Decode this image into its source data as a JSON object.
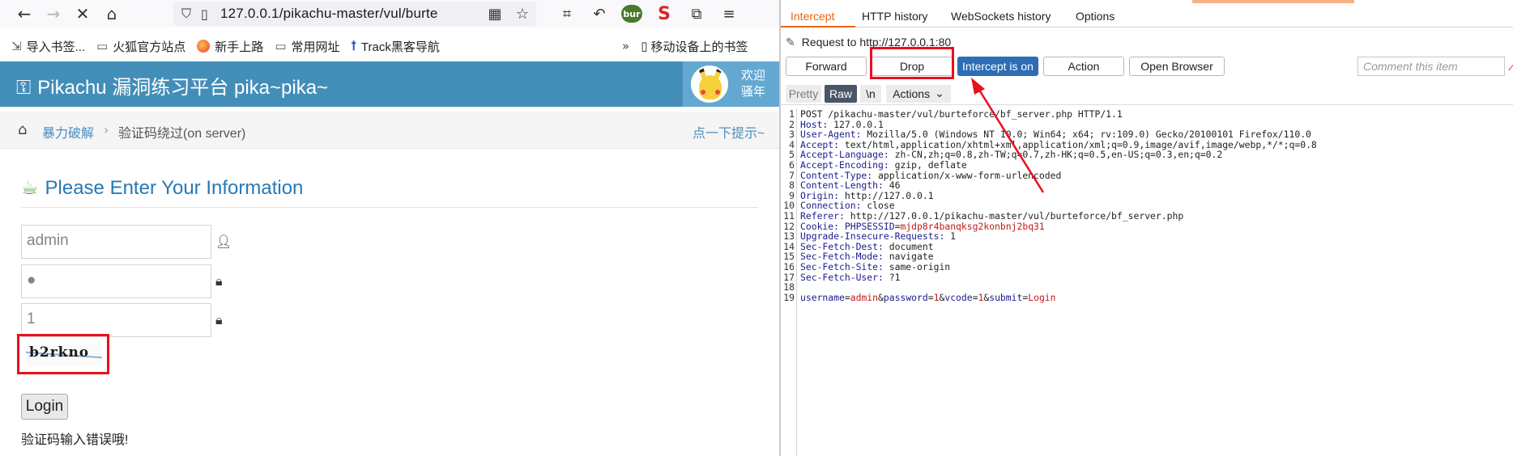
{
  "browser": {
    "nav": {
      "back_icon": "←",
      "forward_icon": "→",
      "stop_icon": "✕",
      "home_icon": "⌂"
    },
    "url": "127.0.0.1/pikachu-master/vul/burte",
    "bookmarks": [
      {
        "label": "导入书签...",
        "icon": "⇲"
      },
      {
        "label": "火狐官方站点",
        "icon": "folder"
      },
      {
        "label": "新手上路",
        "icon": "firefox"
      },
      {
        "label": "常用网址",
        "icon": "folder"
      },
      {
        "label": "Track黑客导航",
        "icon": "track"
      }
    ],
    "mobile_bookmarks": "移动设备上的书签",
    "burp_extension_badge": "bur",
    "s_extension_badge": "S"
  },
  "site": {
    "title": "Pikachu 漏洞练习平台 pika~pika~",
    "welcome_line1": "欢迎",
    "welcome_line2": "骚年",
    "breadcrumb_link": "暴力破解",
    "breadcrumb_current": "验证码绕过(on server)",
    "hint_link": "点一下提示~",
    "form_title": "Please Enter Your Information",
    "username_value": "admin",
    "password_value": "●",
    "vcode_value": "1",
    "captcha_text": "b2rkno",
    "login_label": "Login",
    "error_message": "验证码输入错误哦!"
  },
  "burp": {
    "tabs": [
      "Intercept",
      "HTTP history",
      "WebSockets history",
      "Options"
    ],
    "active_tab": "Intercept",
    "request_to": "Request to http://127.0.0.1:80",
    "buttons": {
      "forward": "Forward",
      "drop": "Drop",
      "intercept": "Intercept is on",
      "action": "Action",
      "open_browser": "Open Browser"
    },
    "comment_placeholder": "Comment this item",
    "view_buttons": {
      "pretty": "Pretty",
      "raw": "Raw",
      "newline": "\\n",
      "actions": "Actions"
    },
    "request_lines": [
      {
        "n": "1",
        "k": "",
        "v": "POST /pikachu-master/vul/burteforce/bf_server.php HTTP/1.1"
      },
      {
        "n": "2",
        "k": "Host",
        "v": "127.0.0.1"
      },
      {
        "n": "3",
        "k": "User-Agent",
        "v": "Mozilla/5.0 (Windows NT 10.0; Win64; x64; rv:109.0) Gecko/20100101 Firefox/110.0"
      },
      {
        "n": "4",
        "k": "Accept",
        "v": "text/html,application/xhtml+xml,application/xml;q=0.9,image/avif,image/webp,*/*;q=0.8"
      },
      {
        "n": "5",
        "k": "Accept-Language",
        "v": "zh-CN,zh;q=0.8,zh-TW;q=0.7,zh-HK;q=0.5,en-US;q=0.3,en;q=0.2"
      },
      {
        "n": "6",
        "k": "Accept-Encoding",
        "v": "gzip, deflate"
      },
      {
        "n": "7",
        "k": "Content-Type",
        "v": "application/x-www-form-urlencoded"
      },
      {
        "n": "8",
        "k": "Content-Length",
        "v": "46"
      },
      {
        "n": "9",
        "k": "Origin",
        "v": "http://127.0.0.1"
      },
      {
        "n": "10",
        "k": "Connection",
        "v": "close"
      },
      {
        "n": "11",
        "k": "Referer",
        "v": "http://127.0.0.1/pikachu-master/vul/burteforce/bf_server.php"
      },
      {
        "n": "12",
        "k": "Cookie",
        "v": "PHPSESSID=mjdp8r4banqksg2konbnj2bq31"
      },
      {
        "n": "13",
        "k": "Upgrade-Insecure-Requests",
        "v": "1"
      },
      {
        "n": "14",
        "k": "Sec-Fetch-Dest",
        "v": "document"
      },
      {
        "n": "15",
        "k": "Sec-Fetch-Mode",
        "v": "navigate"
      },
      {
        "n": "16",
        "k": "Sec-Fetch-Site",
        "v": "same-origin"
      },
      {
        "n": "17",
        "k": "Sec-Fetch-User",
        "v": "?1"
      },
      {
        "n": "18",
        "k": "",
        "v": ""
      },
      {
        "n": "19",
        "k": "",
        "v": "username=admin&password=1&vcode=1&submit=Login"
      }
    ]
  },
  "colors": {
    "header_blue": "#438eb9",
    "accent_orange": "#e8650d",
    "intercept_blue": "#2d6db5",
    "annotation_red": "#e8101e"
  }
}
